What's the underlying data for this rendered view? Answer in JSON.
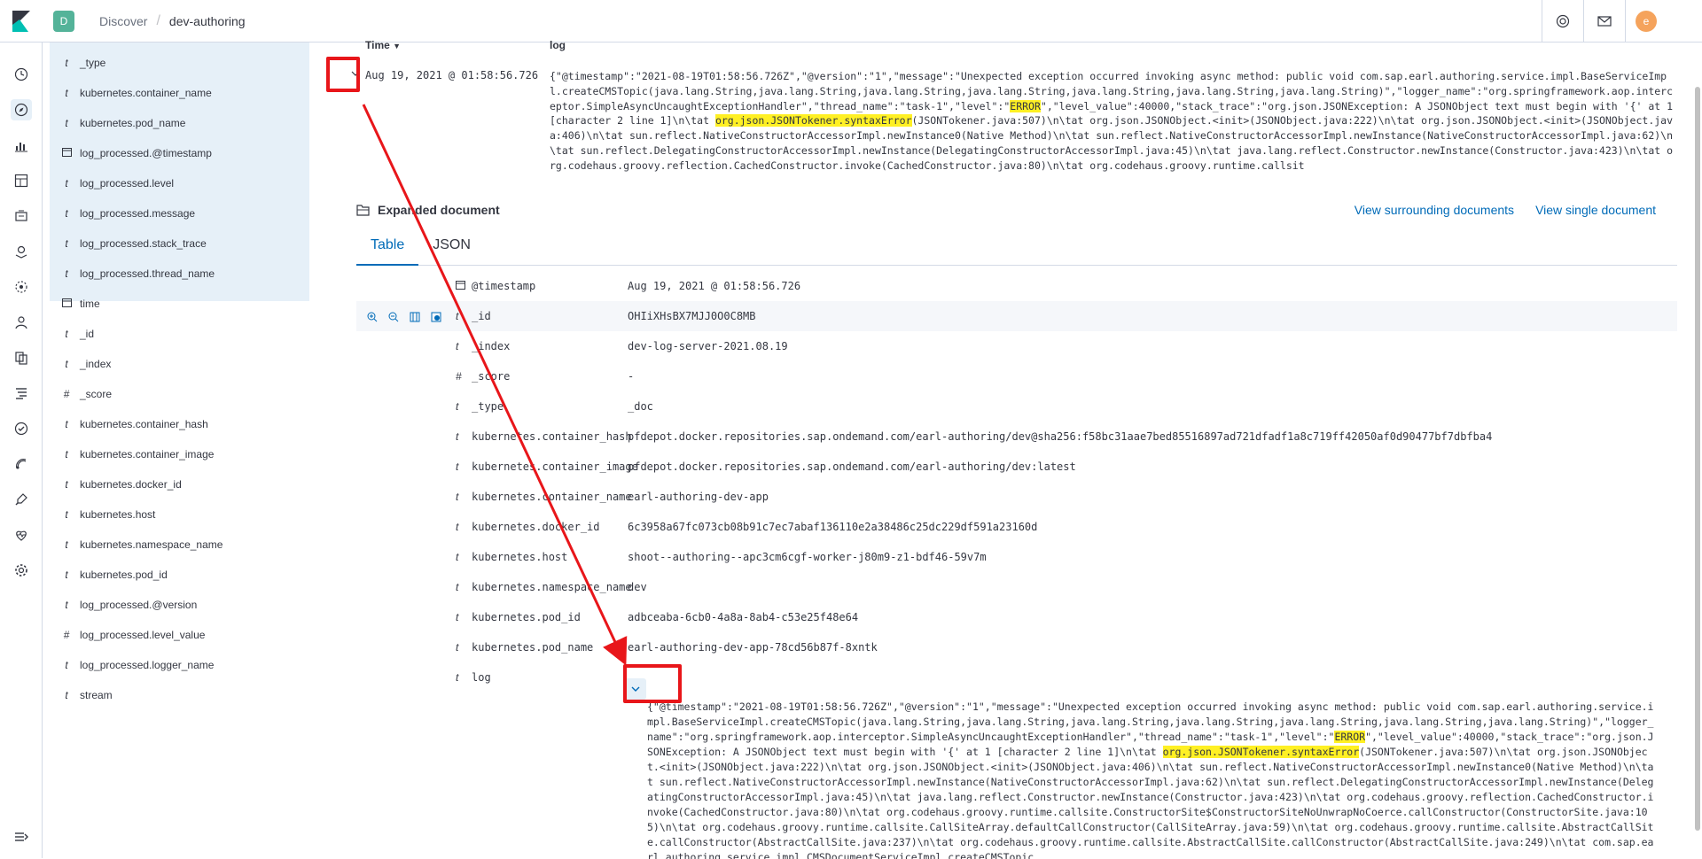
{
  "header": {
    "space_initial": "D",
    "breadcrumb": [
      "Discover",
      "dev-authoring"
    ],
    "avatar_initial": "e",
    "icons": [
      "help-icon",
      "mail-icon"
    ]
  },
  "rail": {
    "icons": [
      "clock-icon",
      "compass-icon",
      "visualize-icon",
      "dashboard-icon",
      "canvas-icon",
      "maps-icon",
      "ml-icon",
      "graph-icon",
      "apm-icon",
      "logs-icon",
      "uptime-icon",
      "siem-icon",
      "dev-tools-icon",
      "monitoring-icon",
      "management-icon",
      "menu-collapse-icon"
    ]
  },
  "fields": [
    {
      "type": "t",
      "name": "_type"
    },
    {
      "type": "t",
      "name": "kubernetes.container_name"
    },
    {
      "type": "t",
      "name": "kubernetes.pod_name"
    },
    {
      "type": "cal",
      "name": "log_processed.@timestamp"
    },
    {
      "type": "t",
      "name": "log_processed.level"
    },
    {
      "type": "t",
      "name": "log_processed.message"
    },
    {
      "type": "t",
      "name": "log_processed.stack_trace"
    },
    {
      "type": "t",
      "name": "log_processed.thread_name"
    },
    {
      "type": "cal",
      "name": "time"
    },
    {
      "type": "t",
      "name": "_id"
    },
    {
      "type": "t",
      "name": "_index"
    },
    {
      "type": "#",
      "name": "_score"
    },
    {
      "type": "t",
      "name": "kubernetes.container_hash"
    },
    {
      "type": "t",
      "name": "kubernetes.container_image"
    },
    {
      "type": "t",
      "name": "kubernetes.docker_id"
    },
    {
      "type": "t",
      "name": "kubernetes.host"
    },
    {
      "type": "t",
      "name": "kubernetes.namespace_name"
    },
    {
      "type": "t",
      "name": "kubernetes.pod_id"
    },
    {
      "type": "t",
      "name": "log_processed.@version"
    },
    {
      "type": "#",
      "name": "log_processed.level_value"
    },
    {
      "type": "t",
      "name": "log_processed.logger_name"
    },
    {
      "type": "t",
      "name": "stream"
    }
  ],
  "table": {
    "col_time": "Time",
    "col_log": "log",
    "row_time": "Aug 19, 2021 @ 01:58:56.726",
    "row_log_before": "{\"@timestamp\":\"2021-08-19T01:58:56.726Z\",\"@version\":\"1\",\"message\":\"Unexpected exception occurred invoking async method: public void com.sap.earl.authoring.service.impl.BaseServiceImpl.createCMSTopic(java.lang.String,java.lang.String,java.lang.String,java.lang.String,java.lang.String,java.lang.String,java.lang.String)\",\"logger_name\":\"org.springframework.aop.interceptor.SimpleAsyncUncaughtExceptionHandler\",\"thread_name\":\"task-1\",\"level\":\"",
    "row_log_error": "ERROR",
    "row_log_mid": "\",\"level_value\":40000,\"stack_trace\":\"org.json.JSONException: A JSONObject text must begin with '{' at 1 [character 2 line 1]\\n\\tat ",
    "row_log_hl": "org.json.JSONTokener.syntaxError",
    "row_log_after": "(JSONTokener.java:507)\\n\\tat org.json.JSONObject.<init>(JSONObject.java:222)\\n\\tat org.json.JSONObject.<init>(JSONObject.java:406)\\n\\tat sun.reflect.NativeConstructorAccessorImpl.newInstance0(Native Method)\\n\\tat sun.reflect.NativeConstructorAccessorImpl.newInstance(NativeConstructorAccessorImpl.java:62)\\n\\tat sun.reflect.DelegatingConstructorAccessorImpl.newInstance(DelegatingConstructorAccessorImpl.java:45)\\n\\tat java.lang.reflect.Constructor.newInstance(Constructor.java:423)\\n\\tat org.codehaus.groovy.reflection.CachedConstructor.invoke(CachedConstructor.java:80)\\n\\tat org.codehaus.groovy.runtime.callsit"
  },
  "expanded": {
    "title": "Expanded document",
    "link_surrounding": "View surrounding documents",
    "link_single": "View single document",
    "tab_table": "Table",
    "tab_json": "JSON"
  },
  "doc_rows": [
    {
      "type": "cal",
      "field": "@timestamp",
      "value": "Aug 19, 2021 @ 01:58:56.726"
    },
    {
      "type": "t",
      "field": "_id",
      "value": "OHIiXHsBX7MJJ0O0C8MB"
    },
    {
      "type": "t",
      "field": "_index",
      "value": "dev-log-server-2021.08.19"
    },
    {
      "type": "#",
      "field": "_score",
      "value": " -"
    },
    {
      "type": "t",
      "field": "_type",
      "value": "_doc"
    },
    {
      "type": "t",
      "field": "kubernetes.container_hash",
      "value": "pfdepot.docker.repositories.sap.ondemand.com/earl-authoring/dev@sha256:f58bc31aae7bed85516897ad721dfadf1a8c719ff42050af0d90477bf7dbfba4"
    },
    {
      "type": "t",
      "field": "kubernetes.container_image",
      "value": "pfdepot.docker.repositories.sap.ondemand.com/earl-authoring/dev:latest"
    },
    {
      "type": "t",
      "field": "kubernetes.container_name",
      "value": "earl-authoring-dev-app"
    },
    {
      "type": "t",
      "field": "kubernetes.docker_id",
      "value": "6c3958a67fc073cb08b91c7ec7abaf136110e2a38486c25dc229df591a23160d"
    },
    {
      "type": "t",
      "field": "kubernetes.host",
      "value": "shoot--authoring--apc3cm6cgf-worker-j80m9-z1-bdf46-59v7m"
    },
    {
      "type": "t",
      "field": "kubernetes.namespace_name",
      "value": "dev"
    },
    {
      "type": "t",
      "field": "kubernetes.pod_id",
      "value": "adbceaba-6cb0-4a8a-8ab4-c53e25f48e64"
    },
    {
      "type": "t",
      "field": "kubernetes.pod_name",
      "value": "earl-authoring-dev-app-78cd56b87f-8xntk"
    },
    {
      "type": "t",
      "field": "log",
      "value": ""
    }
  ],
  "log_value": {
    "before": "{\"@timestamp\":\"2021-08-19T01:58:56.726Z\",\"@version\":\"1\",\"message\":\"Unexpected exception occurred invoking async method: public void com.sap.earl.authoring.service.impl.BaseServiceImpl.createCMSTopic(java.lang.String,java.lang.String,java.lang.String,java.lang.String,java.lang.String,java.lang.String,java.lang.String)\",\"logger_name\":\"org.springframework.aop.interceptor.SimpleAsyncUncaughtExceptionHandler\",\"thread_name\":\"task-1\",\"level\":\"",
    "error": "ERROR",
    "mid": "\",\"level_value\":40000,\"stack_trace\":\"org.json.JSONException: A JSONObject text must begin with '{' at 1 [character 2 line 1]\\n\\tat ",
    "hl": "org.json.JSONTokener.syntaxError",
    "after": "(JSONTokener.java:507)\\n\\tat org.json.JSONObject.<init>(JSONObject.java:222)\\n\\tat org.json.JSONObject.<init>(JSONObject.java:406)\\n\\tat sun.reflect.NativeConstructorAccessorImpl.newInstance0(Native Method)\\n\\tat sun.reflect.NativeConstructorAccessorImpl.newInstance(NativeConstructorAccessorImpl.java:62)\\n\\tat sun.reflect.DelegatingConstructorAccessorImpl.newInstance(DelegatingConstructorAccessorImpl.java:45)\\n\\tat java.lang.reflect.Constructor.newInstance(Constructor.java:423)\\n\\tat org.codehaus.groovy.reflection.CachedConstructor.invoke(CachedConstructor.java:80)\\n\\tat org.codehaus.groovy.runtime.callsite.ConstructorSite$ConstructorSiteNoUnwrapNoCoerce.callConstructor(ConstructorSite.java:105)\\n\\tat org.codehaus.groovy.runtime.callsite.CallSiteArray.defaultCallConstructor(CallSiteArray.java:59)\\n\\tat org.codehaus.groovy.runtime.callsite.AbstractCallSite.callConstructor(AbstractCallSite.java:237)\\n\\tat org.codehaus.groovy.runtime.callsite.AbstractCallSite.callConstructor(AbstractCallSite.java:249)\\n\\tat com.sap.earl.authoring.service.impl.CMSDocumentServiceImpl.createCMSTopic"
  },
  "colors": {
    "accent": "#006bb8",
    "highlight": "#fff024",
    "annotation": "#e8161a",
    "selected_bg": "#e6f0f8"
  }
}
